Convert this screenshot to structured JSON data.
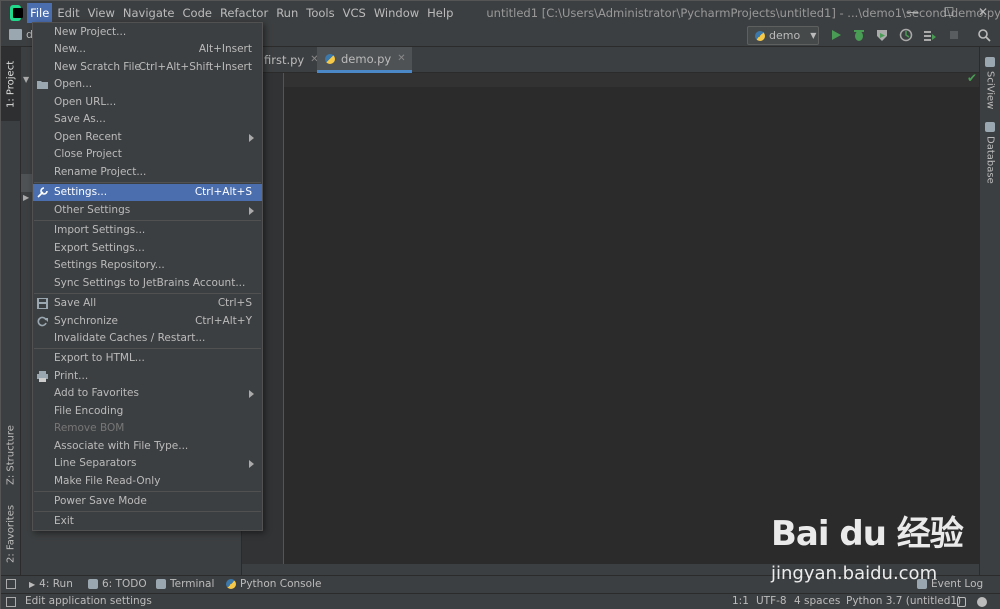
{
  "menubar": {
    "items": [
      "File",
      "Edit",
      "View",
      "Navigate",
      "Code",
      "Refactor",
      "Run",
      "Tools",
      "VCS",
      "Window",
      "Help"
    ],
    "active": "File"
  },
  "window_title": "untitled1 [C:\\Users\\Administrator\\PycharmProjects\\untitled1] - ...\\demo1\\second\\demo.py",
  "window_controls": {
    "minimize": "—",
    "maximize": "☐",
    "close": "✕"
  },
  "navbar": {
    "crumb": "d"
  },
  "toolbar": {
    "run_config": "demo"
  },
  "left_tabs": {
    "project": "1: Project",
    "structure": "Z: Structure",
    "favorites": "2: Favorites"
  },
  "right_tabs": {
    "sciview": "SciView",
    "database": "Database"
  },
  "editor": {
    "tabs": [
      {
        "label": "first.py",
        "active": false
      },
      {
        "label": "demo.py",
        "active": true
      }
    ]
  },
  "file_menu": [
    {
      "label": "New Project...",
      "shortcut": ""
    },
    {
      "label": "New...",
      "shortcut": "Alt+Insert"
    },
    {
      "label": "New Scratch File",
      "shortcut": "Ctrl+Alt+Shift+Insert"
    },
    {
      "label": "Open...",
      "shortcut": "",
      "icon": "folder-icon"
    },
    {
      "label": "Open URL...",
      "shortcut": ""
    },
    {
      "label": "Save As...",
      "shortcut": ""
    },
    {
      "label": "Open Recent",
      "shortcut": "",
      "submenu": true
    },
    {
      "label": "Close Project",
      "shortcut": ""
    },
    {
      "label": "Rename Project...",
      "shortcut": ""
    },
    {
      "label": "Settings...",
      "shortcut": "Ctrl+Alt+S",
      "selected": true,
      "icon": "wrench-icon"
    },
    {
      "label": "Other Settings",
      "shortcut": "",
      "submenu": true
    },
    {
      "label": "Import Settings...",
      "shortcut": ""
    },
    {
      "label": "Export Settings...",
      "shortcut": ""
    },
    {
      "label": "Settings Repository...",
      "shortcut": ""
    },
    {
      "label": "Sync Settings to JetBrains Account...",
      "shortcut": ""
    },
    {
      "label": "Save All",
      "shortcut": "Ctrl+S",
      "icon": "save-icon"
    },
    {
      "label": "Synchronize",
      "shortcut": "Ctrl+Alt+Y",
      "icon": "sync-icon"
    },
    {
      "label": "Invalidate Caches / Restart...",
      "shortcut": ""
    },
    {
      "label": "Export to HTML...",
      "shortcut": ""
    },
    {
      "label": "Print...",
      "shortcut": "",
      "icon": "print-icon"
    },
    {
      "label": "Add to Favorites",
      "shortcut": "",
      "submenu": true
    },
    {
      "label": "File Encoding",
      "shortcut": ""
    },
    {
      "label": "Remove BOM",
      "shortcut": "",
      "disabled": true
    },
    {
      "label": "Associate with File Type...",
      "shortcut": ""
    },
    {
      "label": "Line Separators",
      "shortcut": "",
      "submenu": true
    },
    {
      "label": "Make File Read-Only",
      "shortcut": ""
    },
    {
      "label": "Power Save Mode",
      "shortcut": ""
    },
    {
      "label": "Exit",
      "shortcut": ""
    }
  ],
  "bottom_tools": {
    "run": "4: Run",
    "todo": "6: TODO",
    "terminal": "Terminal",
    "python_console": "Python Console",
    "event_log": "Event Log"
  },
  "status": {
    "message": "Edit application settings",
    "position": "1:1",
    "encoding": "UTF-8",
    "indent": "4 spaces",
    "interpreter": "Python 3.7 (untitled1)"
  },
  "watermark": {
    "logo": "Bai du 经验",
    "url": "jingyan.baidu.com"
  },
  "colors": {
    "selection": "#4b6eaf",
    "background": "#3c3f41",
    "editor": "#2b2b2b",
    "run_green": "#499c54"
  }
}
